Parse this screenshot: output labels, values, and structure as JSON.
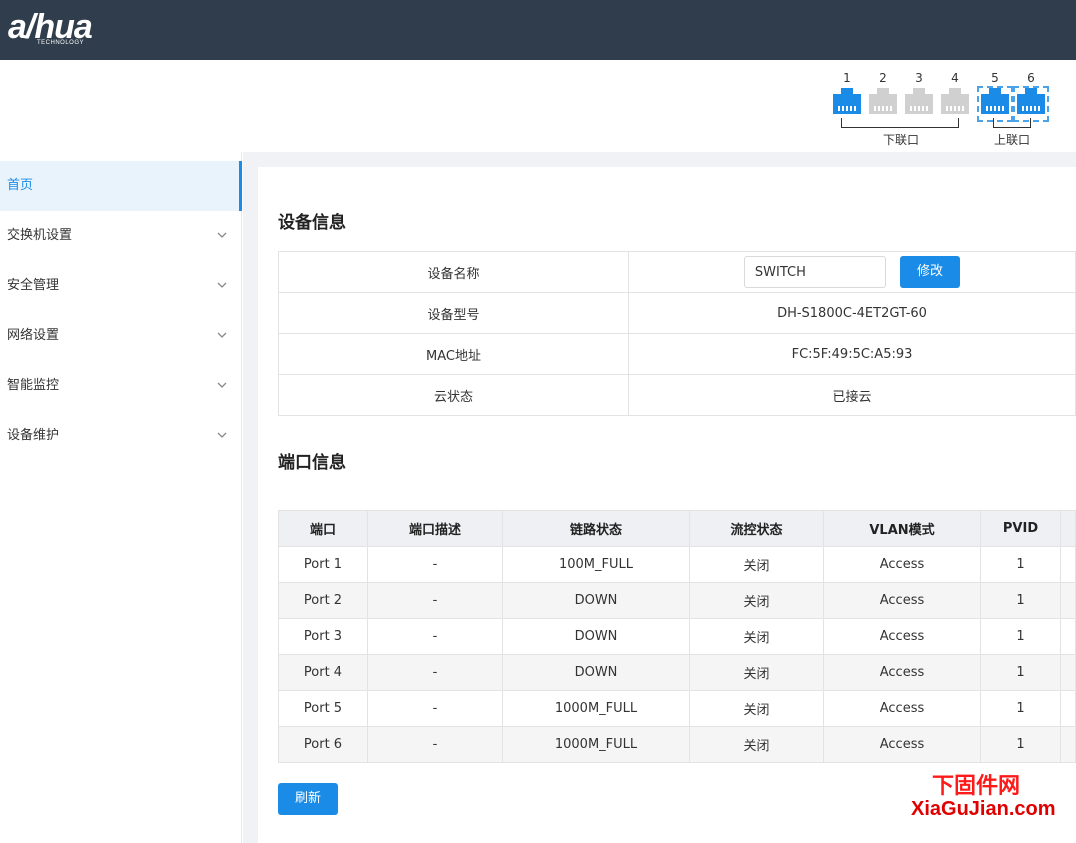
{
  "header": {
    "logo": "a/hua",
    "logo_sub": "TECHNOLOGY"
  },
  "ports_panel": {
    "ports": [
      {
        "num": "1",
        "status": "up"
      },
      {
        "num": "2",
        "status": "down"
      },
      {
        "num": "3",
        "status": "down"
      },
      {
        "num": "4",
        "status": "down"
      },
      {
        "num": "5",
        "status": "up"
      },
      {
        "num": "6",
        "status": "up"
      }
    ],
    "downlink_label": "下联口",
    "uplink_label": "上联口"
  },
  "sidebar": {
    "items": [
      {
        "label": "首页"
      },
      {
        "label": "交换机设置"
      },
      {
        "label": "安全管理"
      },
      {
        "label": "网络设置"
      },
      {
        "label": "智能监控"
      },
      {
        "label": "设备维护"
      }
    ]
  },
  "device_info": {
    "title": "设备信息",
    "rows": [
      {
        "key": "设备名称",
        "value": "SWITCH"
      },
      {
        "key": "设备型号",
        "value": "DH-S1800C-4ET2GT-60"
      },
      {
        "key": "MAC地址",
        "value": "FC:5F:49:5C:A5:93"
      },
      {
        "key": "云状态",
        "value": "已接云"
      }
    ],
    "modify_label": "修改"
  },
  "port_info": {
    "title": "端口信息",
    "columns": [
      "端口",
      "端口描述",
      "链路状态",
      "流控状态",
      "VLAN模式",
      "PVID"
    ],
    "rows": [
      [
        "Port 1",
        "-",
        "100M_FULL",
        "关闭",
        "Access",
        "1"
      ],
      [
        "Port 2",
        "-",
        "DOWN",
        "关闭",
        "Access",
        "1"
      ],
      [
        "Port 3",
        "-",
        "DOWN",
        "关闭",
        "Access",
        "1"
      ],
      [
        "Port 4",
        "-",
        "DOWN",
        "关闭",
        "Access",
        "1"
      ],
      [
        "Port 5",
        "-",
        "1000M_FULL",
        "关闭",
        "Access",
        "1"
      ],
      [
        "Port 6",
        "-",
        "1000M_FULL",
        "关闭",
        "Access",
        "1"
      ]
    ],
    "refresh_label": "刷新"
  },
  "watermark": {
    "cn": "下固件网",
    "en": "XiaGuJian.com"
  },
  "colors": {
    "header_bg": "#2f3d4c",
    "accent": "#1a8ce8",
    "port_down": "#d0d0d0"
  }
}
